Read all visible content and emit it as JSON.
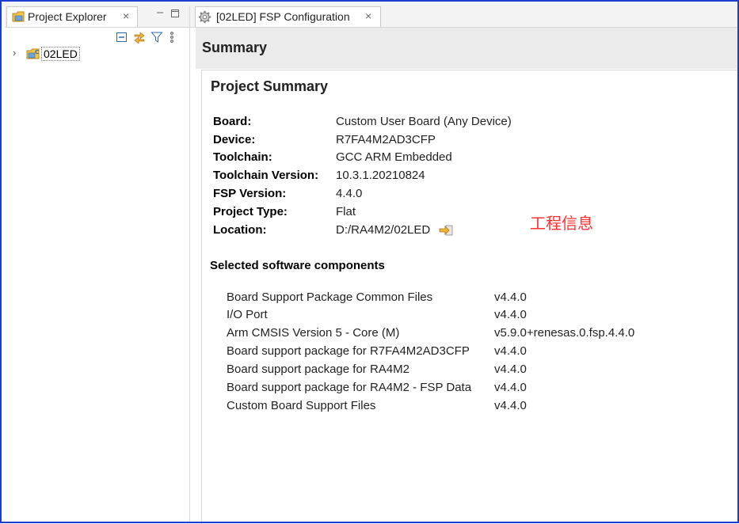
{
  "left_panel": {
    "tab_label": "Project Explorer",
    "close_glyph": "×",
    "tree": [
      {
        "label": "02LED",
        "expand_glyph": "›"
      }
    ]
  },
  "editor": {
    "tab_label": "[02LED] FSP Configuration",
    "close_glyph": "×",
    "header_title": "Summary",
    "project_summary_title": "Project Summary",
    "info": [
      {
        "key": "Board:",
        "value": "Custom User Board (Any Device)"
      },
      {
        "key": "Device:",
        "value": "R7FA4M2AD3CFP"
      },
      {
        "key": "Toolchain:",
        "value": "GCC ARM Embedded"
      },
      {
        "key": "Toolchain Version:",
        "value": "10.3.1.20210824"
      },
      {
        "key": "FSP Version:",
        "value": "4.4.0"
      },
      {
        "key": "Project Type:",
        "value": "Flat"
      },
      {
        "key": "Location:",
        "value": "D:/RA4M2/02LED"
      }
    ],
    "annotation": "工程信息",
    "components_title": "Selected software components",
    "components": [
      {
        "name": "Board Support Package Common Files",
        "version": "v4.4.0"
      },
      {
        "name": "I/O Port",
        "version": "v4.4.0"
      },
      {
        "name": "Arm CMSIS Version 5 - Core (M)",
        "version": "v5.9.0+renesas.0.fsp.4.4.0"
      },
      {
        "name": "Board support package for R7FA4M2AD3CFP",
        "version": "v4.4.0"
      },
      {
        "name": "Board support package for RA4M2",
        "version": "v4.4.0"
      },
      {
        "name": "Board support package for RA4M2 - FSP Data",
        "version": "v4.4.0"
      },
      {
        "name": "Custom Board Support Files",
        "version": "v4.4.0"
      }
    ]
  },
  "colors": {
    "annotation": "#ff3030",
    "frame_border": "#1a3fd0"
  }
}
